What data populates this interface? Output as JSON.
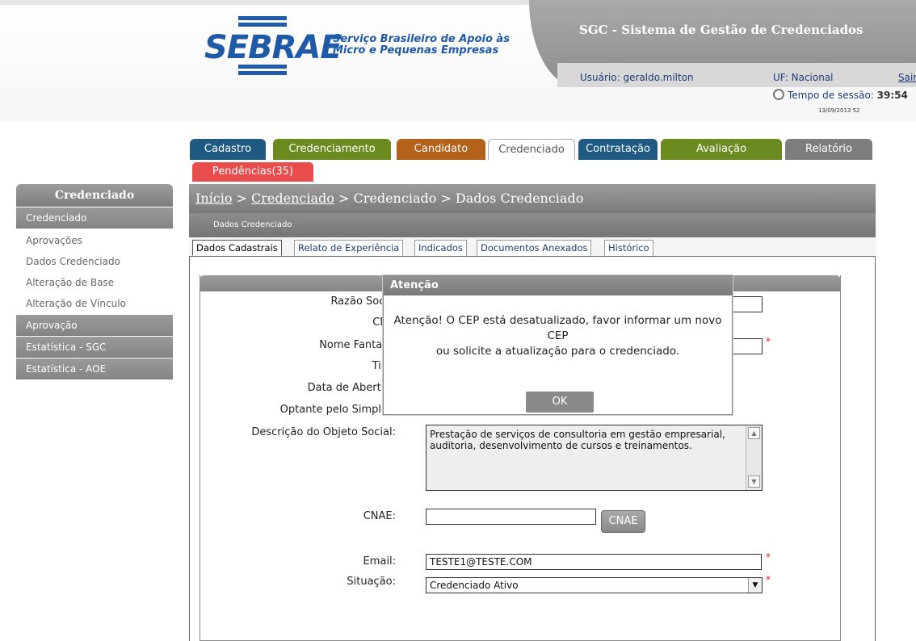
{
  "header": {
    "logo_text": "SEBRAE",
    "logo_tagline_1": "Serviço Brasileiro de Apoio às",
    "logo_tagline_2": "Micro e Pequenas Empresas",
    "system_title": "SGC - Sistema de Gestão de Credenciados",
    "usuario": "Usuário: geraldo.milton",
    "uf": "UF: Nacional",
    "sair": "Sair",
    "session_label": "Tempo de sessão:",
    "session_time": "39:54",
    "datestamp": "13/09/2013 52"
  },
  "tabs": [
    {
      "label": "Cadastro",
      "color": "#1e5a82"
    },
    {
      "label": "Credenciamento",
      "color": "#6b8a1f"
    },
    {
      "label": "Candidato",
      "color": "#b4621a"
    },
    {
      "label": "Credenciado",
      "color": "#ffffff"
    },
    {
      "label": "Contratação",
      "color": "#1e5a82"
    },
    {
      "label": "Avaliação",
      "color": "#6b8a1f"
    },
    {
      "label": "Relatório",
      "color": "#7d7d7d"
    }
  ],
  "pendencias": "Pendências(35)",
  "sidebar": {
    "title": "Credenciado",
    "items": [
      {
        "label": "Credenciado"
      },
      {
        "label": "Aprovações"
      },
      {
        "label": "Dados Credenciado"
      },
      {
        "label": "Alteração de Base"
      },
      {
        "label": "Alteração de Vínculo"
      },
      {
        "label": "Aprovação"
      },
      {
        "label": "Estatística - SGC"
      },
      {
        "label": "Estatística - AOE"
      }
    ]
  },
  "breadcrumb": {
    "inicio": "Início",
    "sep1": " > ",
    "credenciado_link": "Credenciado",
    "rest": " > Credenciado > Dados Credenciado"
  },
  "subbar_title": "Dados Credenciado",
  "subtabs": [
    "Dados Cadastrais",
    "Relato de Experiência",
    "Indicados",
    "Documentos Anexados",
    "Histórico"
  ],
  "form": {
    "razao_label": "Razão Soci",
    "cnpj_label": "CN",
    "fantasia_label": "Nome Fantas",
    "tipo_label": "Tip",
    "abertura_label": "Data de Abertu",
    "simples_label": "Optante pelo Simple",
    "objeto_label": "Descrição do Objeto Social:",
    "objeto_value": "Prestação de serviços de consultoria em gestão empresarial, auditoria, desenvolvimento de cursos e treinamentos.",
    "cnae_label": "CNAE:",
    "cnae_value": "",
    "cnae_button": "CNAE",
    "email_label": "Email:",
    "email_value": "TESTE1@TESTE.COM",
    "situacao_label": "Situação:",
    "situacao_value": "Credenciado Ativo",
    "required_mark": "*"
  },
  "modal": {
    "title": "Atenção",
    "message_1": "Atenção! O CEP está desatualizado, favor informar um novo CEP",
    "message_2": "ou solicite a atualização para o credenciado.",
    "ok": "OK"
  }
}
